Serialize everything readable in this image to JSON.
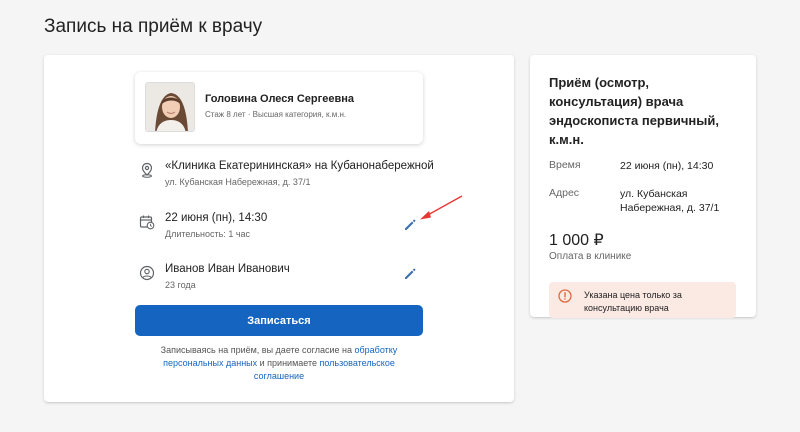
{
  "page": {
    "title": "Запись на приём к врачу"
  },
  "doctor": {
    "name": "Головина Олеся Сергеевна",
    "meta": "Стаж 8 лет · Высшая категория, к.м.н."
  },
  "clinic": {
    "name": "«Клиника Екатерининская» на Кубанонабережной",
    "address": "ул. Кубанская Набережная, д. 37/1"
  },
  "appointment": {
    "datetime": "22 июня (пн), 14:30",
    "duration": "Длительность: 1 час"
  },
  "patient": {
    "name": "Иванов Иван Иванович",
    "age": "23 года"
  },
  "actions": {
    "submit_label": "Записаться"
  },
  "consent": {
    "text_1": "Записываясь на приём, вы даете согласие на ",
    "link_1": "обработку персональных данных",
    "text_2": " и принимаете ",
    "link_2": "пользовательское соглашение"
  },
  "summary": {
    "service": "Приём (осмотр, консультация) врача эндоскописта первичный, к.м.н.",
    "time_label": "Время",
    "time_value": "22 июня (пн), 14:30",
    "address_label": "Адрес",
    "address_value": "ул. Кубанская Набережная, д. 37/1",
    "price": "1 000 ₽",
    "payment": "Оплата в клинике",
    "notice": "Указана цена только за консультацию врача"
  },
  "colors": {
    "accent": "#1565c0",
    "notice_bg": "#fbe9e4",
    "notice_icon": "#e06a3c",
    "annotation_arrow": "#e53935"
  }
}
